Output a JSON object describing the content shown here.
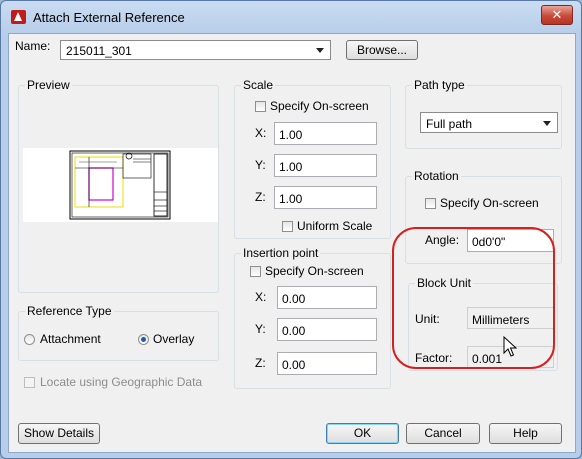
{
  "window": {
    "title": "Attach External Reference",
    "close_glyph": "✕"
  },
  "name_row": {
    "label": "Name:",
    "value": "215011_301",
    "browse_label": "Browse..."
  },
  "preview": {
    "title": "Preview"
  },
  "scale": {
    "title": "Scale",
    "specify_onscreen_label": "Specify On-screen",
    "x_label": "X:",
    "x_value": "1.00",
    "y_label": "Y:",
    "y_value": "1.00",
    "z_label": "Z:",
    "z_value": "1.00",
    "uniform_label": "Uniform Scale"
  },
  "insertion": {
    "title": "Insertion point",
    "specify_onscreen_label": "Specify On-screen",
    "x_label": "X:",
    "x_value": "0.00",
    "y_label": "Y:",
    "y_value": "0.00",
    "z_label": "Z:",
    "z_value": "0.00"
  },
  "path_type": {
    "title": "Path type",
    "value": "Full path"
  },
  "rotation": {
    "title": "Rotation",
    "specify_onscreen_label": "Specify On-screen",
    "angle_label": "Angle:",
    "angle_value": "0d0'0\""
  },
  "block_unit": {
    "title": "Block Unit",
    "unit_label": "Unit:",
    "unit_value": "Millimeters",
    "factor_label": "Factor:",
    "factor_value": "0.001"
  },
  "reference_type": {
    "title": "Reference Type",
    "attachment_label": "Attachment",
    "overlay_label": "Overlay",
    "selected": "Overlay"
  },
  "geo": {
    "label": "Locate using Geographic Data"
  },
  "buttons": {
    "show_details": "Show Details",
    "ok": "OK",
    "cancel": "Cancel",
    "help": "Help"
  },
  "colors": {
    "highlight": "#d62020",
    "preview_magenta": "#d000d0",
    "preview_yellow": "#e8e000"
  }
}
